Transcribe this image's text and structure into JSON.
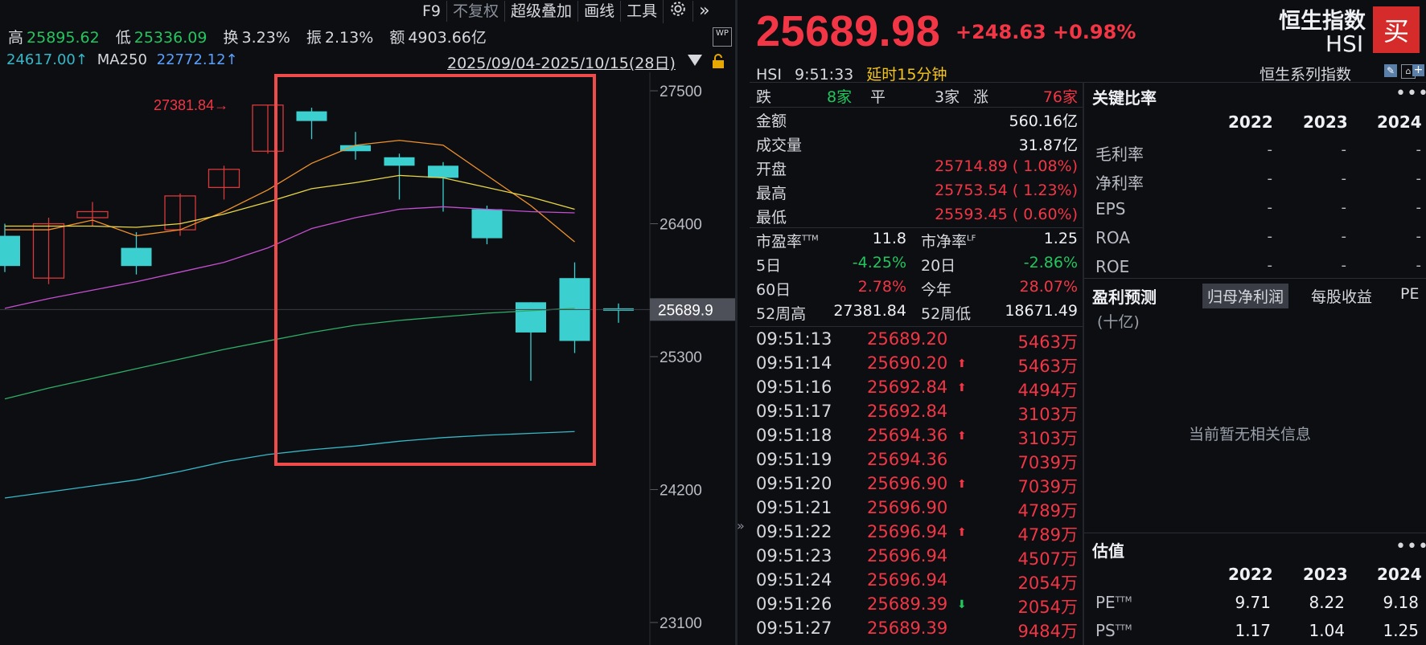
{
  "toolbar": {
    "items": [
      "F9",
      "不复权",
      "超级叠加",
      "画线",
      "工具"
    ],
    "gear_icon": "gear-icon",
    "more_icon": "double-chevron-right-icon"
  },
  "left_stats": {
    "high_label": "高",
    "high_value": "25895.62",
    "low_label": "低",
    "low_value": "25336.09",
    "turnover_label": "换",
    "turnover_value": "3.23%",
    "amplitude_label": "振",
    "amplitude_value": "2.13%",
    "amount_label": "额",
    "amount_value": "4903.66亿"
  },
  "ma_row": {
    "ma_value": "24617.00↑",
    "ma250_label": "MA250",
    "ma250_value": "22772.12↑",
    "date_range": "2025/09/04-2025/10/15(28日)"
  },
  "chart_data": {
    "type": "candlestick",
    "y_axis_ticks": [
      27500,
      26400,
      25300,
      24200,
      23100
    ],
    "ylim": [
      23000,
      27600
    ],
    "high_marker": "27381.84",
    "current_price_label": "25689.9",
    "candles": [
      {
        "open": 26300,
        "close": 26050,
        "high": 26400,
        "low": 26000
      },
      {
        "open": 25950,
        "close": 26400,
        "high": 26450,
        "low": 25900
      },
      {
        "open": 26450,
        "close": 26500,
        "high": 26580,
        "low": 26380
      },
      {
        "open": 26200,
        "close": 26050,
        "high": 26330,
        "low": 25980
      },
      {
        "open": 26350,
        "close": 26630,
        "high": 26650,
        "low": 26300
      },
      {
        "open": 26700,
        "close": 26850,
        "high": 26880,
        "low": 26600
      },
      {
        "open": 27000,
        "close": 27381.84,
        "high": 27381.84,
        "low": 26980
      },
      {
        "open": 27330,
        "close": 27250,
        "high": 27360,
        "low": 27100
      },
      {
        "open": 27050,
        "close": 27000,
        "high": 27160,
        "low": 26930
      },
      {
        "open": 26950,
        "close": 26880,
        "high": 26980,
        "low": 26600
      },
      {
        "open": 26880,
        "close": 26780,
        "high": 26910,
        "low": 26500
      },
      {
        "open": 26520,
        "close": 26280,
        "high": 26550,
        "low": 26230
      },
      {
        "open": 25750,
        "close": 25500,
        "high": 25750,
        "low": 25100
      },
      {
        "open": 25950,
        "close": 25430,
        "high": 26080,
        "low": 25330
      },
      {
        "open": 25700,
        "close": 25680,
        "high": 25740,
        "low": 25580
      }
    ],
    "ma_lines": [
      {
        "color": "#f0922b",
        "values": [
          26350,
          26350,
          26430,
          26300,
          26350,
          26500,
          26680,
          26900,
          27050,
          27090,
          27050,
          26800,
          26550,
          26250
        ]
      },
      {
        "color": "#e8d646",
        "values": [
          26380,
          26380,
          26380,
          26370,
          26400,
          26480,
          26580,
          26690,
          26740,
          26800,
          26780,
          26700,
          26620,
          26520
        ]
      },
      {
        "color": "#c54fd0",
        "values": [
          25700,
          25780,
          25850,
          25920,
          26000,
          26080,
          26200,
          26360,
          26450,
          26520,
          26540,
          26520,
          26500,
          26490
        ]
      },
      {
        "color": "#2fae67",
        "values": [
          24950,
          25040,
          25120,
          25200,
          25280,
          25360,
          25430,
          25500,
          25560,
          25600,
          25630,
          25660,
          25680,
          25700
        ]
      },
      {
        "color": "#36b8c8",
        "values": [
          24130,
          24180,
          24230,
          24280,
          24350,
          24430,
          24490,
          24530,
          24560,
          24600,
          24630,
          24650,
          24665,
          24680
        ]
      }
    ]
  },
  "quote": {
    "price": "25689.98",
    "change": "+248.63",
    "change_pct": "+0.98%",
    "index_name": "恒生指数",
    "index_code": "HSI",
    "buy_label": "买",
    "code": "HSI",
    "time": "9:51:33",
    "delay": "延时15分钟",
    "series": "恒生系列指数"
  },
  "breadth": {
    "down_label": "跌",
    "down_value": "8家",
    "flat_label": "平",
    "flat_value": "3家",
    "up_label": "涨",
    "up_value": "76家"
  },
  "stats": [
    {
      "label": "金额",
      "value": "560.16亿",
      "color": "white"
    },
    {
      "label": "成交量",
      "value": "31.87亿",
      "color": "white"
    },
    {
      "label": "开盘",
      "value": "25714.89 ( 1.08%)",
      "color": "red"
    },
    {
      "label": "最高",
      "value": "25753.54 ( 1.23%)",
      "color": "red"
    },
    {
      "label": "最低",
      "value": "25593.45 ( 0.60%)",
      "color": "red"
    }
  ],
  "grid_stats": [
    {
      "l1": "市盈率",
      "s1": "TTM",
      "v1": "11.8",
      "c1": "white",
      "l2": "市净率",
      "s2": "LF",
      "v2": "1.25",
      "c2": "white"
    },
    {
      "l1": "5日",
      "s1": "",
      "v1": "-4.25%",
      "c1": "green",
      "l2": "20日",
      "s2": "",
      "v2": "-2.86%",
      "c2": "green"
    },
    {
      "l1": "60日",
      "s1": "",
      "v1": "2.78%",
      "c1": "red",
      "l2": "今年",
      "s2": "",
      "v2": "28.07%",
      "c2": "red"
    },
    {
      "l1": "52周高",
      "s1": "",
      "v1": "27381.84",
      "c1": "white",
      "l2": "52周低",
      "s2": "",
      "v2": "18671.49",
      "c2": "white"
    }
  ],
  "ticks": [
    {
      "time": "09:51:13",
      "price": "25689.20",
      "arrow": "",
      "vol": "5463万"
    },
    {
      "time": "09:51:14",
      "price": "25690.20",
      "arrow": "up",
      "vol": "5463万"
    },
    {
      "time": "09:51:16",
      "price": "25692.84",
      "arrow": "up",
      "vol": "4494万"
    },
    {
      "time": "09:51:17",
      "price": "25692.84",
      "arrow": "",
      "vol": "3103万"
    },
    {
      "time": "09:51:18",
      "price": "25694.36",
      "arrow": "up",
      "vol": "3103万"
    },
    {
      "time": "09:51:19",
      "price": "25694.36",
      "arrow": "",
      "vol": "7039万"
    },
    {
      "time": "09:51:20",
      "price": "25696.90",
      "arrow": "up",
      "vol": "7039万"
    },
    {
      "time": "09:51:21",
      "price": "25696.90",
      "arrow": "",
      "vol": "4789万"
    },
    {
      "time": "09:51:22",
      "price": "25696.94",
      "arrow": "up",
      "vol": "4789万"
    },
    {
      "time": "09:51:23",
      "price": "25696.94",
      "arrow": "",
      "vol": "4507万"
    },
    {
      "time": "09:51:24",
      "price": "25696.94",
      "arrow": "",
      "vol": "2054万"
    },
    {
      "time": "09:51:26",
      "price": "25689.39",
      "arrow": "down",
      "vol": "2054万"
    },
    {
      "time": "09:51:27",
      "price": "25689.39",
      "arrow": "",
      "vol": "9484万"
    }
  ],
  "ratios": {
    "title": "关键比率",
    "years": [
      "2022",
      "2023",
      "2024"
    ],
    "rows": [
      {
        "label": "毛利率",
        "vals": [
          "-",
          "-",
          "-"
        ]
      },
      {
        "label": "净利率",
        "vals": [
          "-",
          "-",
          "-"
        ]
      },
      {
        "label": "EPS",
        "vals": [
          "-",
          "-",
          "-"
        ]
      },
      {
        "label": "ROA",
        "vals": [
          "-",
          "-",
          "-"
        ]
      },
      {
        "label": "ROE",
        "vals": [
          "-",
          "-",
          "-"
        ]
      }
    ]
  },
  "forecast": {
    "title": "盈利预测",
    "tabs": [
      "归母净利润",
      "每股收益",
      "PE"
    ],
    "unit": "(十亿)",
    "empty": "当前暂无相关信息"
  },
  "valuation": {
    "title": "估值",
    "years": [
      "2022",
      "2023",
      "2024"
    ],
    "rows": [
      {
        "label": "PE",
        "sup": "TTM",
        "vals": [
          "9.71",
          "8.22",
          "9.18"
        ]
      },
      {
        "label": "PS",
        "sup": "TTM",
        "vals": [
          "1.17",
          "1.04",
          "1.25"
        ]
      }
    ]
  }
}
